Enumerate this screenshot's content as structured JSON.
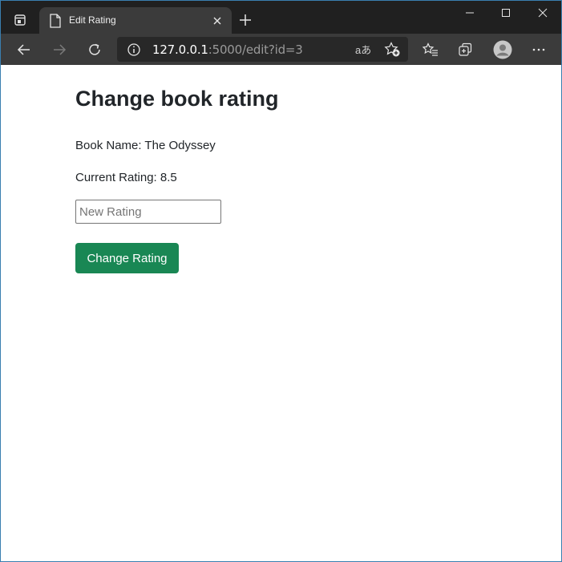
{
  "browser": {
    "tab_title": "Edit Rating",
    "url_host": "127.0.0.1",
    "url_rest": ":5000/edit?id=3",
    "read_aloud_glyph": "aあ"
  },
  "page": {
    "heading": "Change book rating",
    "book_name_text": "Book Name: The Odyssey",
    "current_rating_text": "Current Rating: 8.5",
    "rating_input": {
      "placeholder": "New Rating",
      "value": ""
    },
    "submit_label": "Change Rating"
  },
  "colors": {
    "button_green": "#198754",
    "chrome_dark": "#202020",
    "toolbar": "#3b3b3b"
  }
}
